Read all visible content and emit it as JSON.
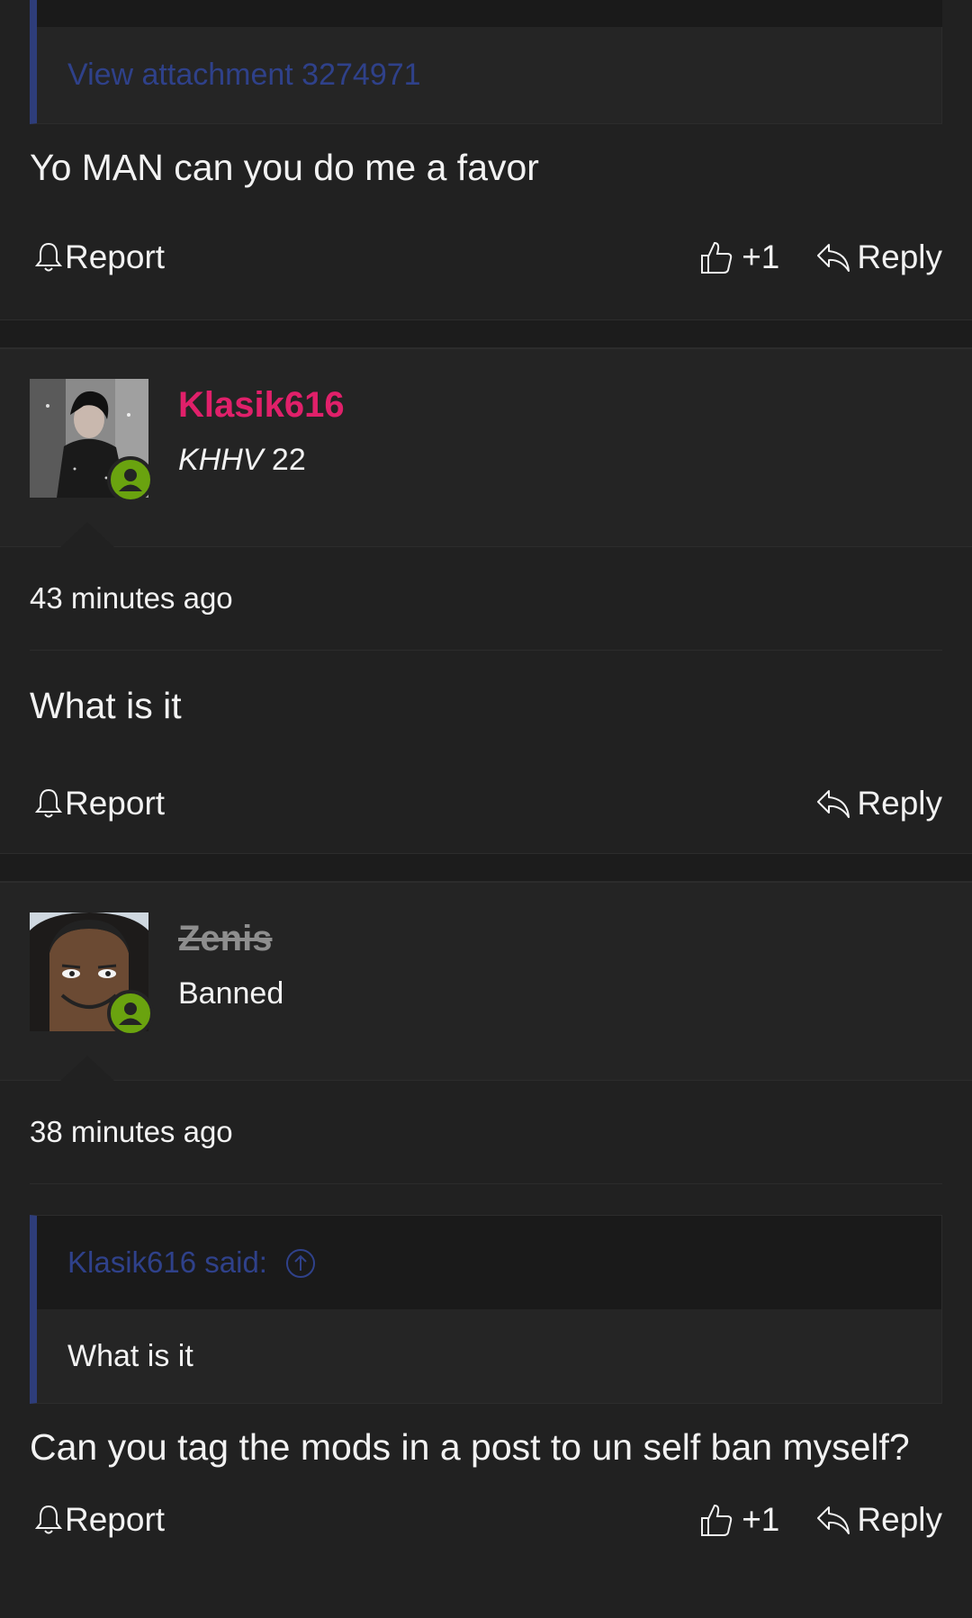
{
  "posts": [
    {
      "attachment_link": "View attachment 3274971",
      "message": "Yo MAN can you do me a favor",
      "report_label": "Report",
      "like_count": "+1",
      "reply_label": "Reply"
    },
    {
      "username": "Klasik616",
      "username_color": "#e0206a",
      "user_title_italic": "KHHV",
      "user_title_rest": " 22",
      "time": "43 minutes ago",
      "message": "What is it",
      "report_label": "Report",
      "reply_label": "Reply"
    },
    {
      "username": "Zenis",
      "username_color": "#8e8e8e",
      "user_title": "Banned",
      "time": "38 minutes ago",
      "quote_author": "Klasik616 said:",
      "quote_text": "What is it",
      "message": "Can you tag the mods in a post to un self ban myself?",
      "report_label": "Report",
      "like_count": "+1",
      "reply_label": "Reply"
    }
  ],
  "colors": {
    "background": "#1c1c1c",
    "post_background": "#212121",
    "quote_accent": "#2e3d7a",
    "link": "#2f418a",
    "online": "#6aa30f"
  },
  "icons": [
    "bell-icon",
    "thumbs-up-icon",
    "reply-arrow-icon",
    "arrow-up-circle-icon",
    "online-user-icon"
  ]
}
